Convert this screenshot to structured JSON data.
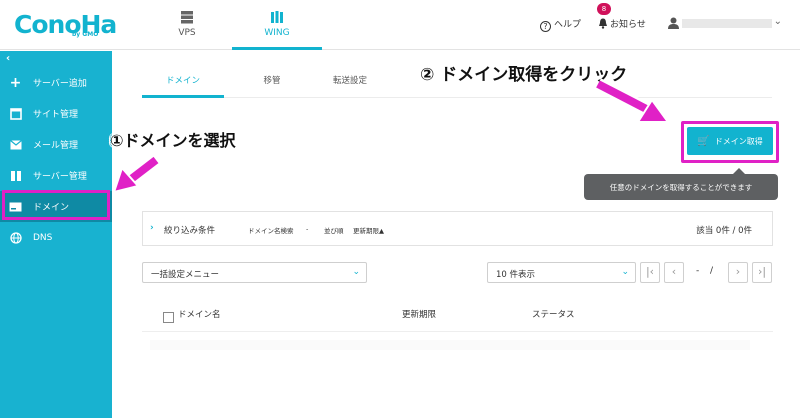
{
  "header": {
    "logo": "ConoHa",
    "logo_sub": "by GMO",
    "nav": [
      {
        "label": "VPS",
        "icon": "server-icon"
      },
      {
        "label": "WING",
        "icon": "wing-icon"
      }
    ],
    "help_label": "ヘルプ",
    "notice_label": "お知らせ",
    "notice_count": "8"
  },
  "sidebar": {
    "back_icon": "‹",
    "items": [
      {
        "label": "サーバー追加",
        "icon": "plus-icon"
      },
      {
        "label": "サイト管理",
        "icon": "window-icon"
      },
      {
        "label": "メール管理",
        "icon": "mail-icon"
      },
      {
        "label": "サーバー管理",
        "icon": "server-manage-icon"
      },
      {
        "label": "ドメイン",
        "icon": "domain-icon"
      },
      {
        "label": "DNS",
        "icon": "globe-icon"
      }
    ]
  },
  "tabs": [
    {
      "label": "ドメイン"
    },
    {
      "label": "移管"
    },
    {
      "label": "転送設定"
    }
  ],
  "main": {
    "acquire_button": "ドメイン取得",
    "tooltip": "任意のドメインを取得することができます",
    "filter": {
      "label": "絞り込み条件",
      "search": "ドメイン名検索",
      "search_val": "-",
      "sort": "並び順",
      "sort_val": "更新期限▲",
      "count": "該当 0件 / 0件"
    },
    "bulk_menu": "一括設定メニュー",
    "per_page": "10 件表示",
    "page_text": "-",
    "page_sep": "/",
    "columns": [
      "ドメイン名",
      "更新期限",
      "ステータス"
    ]
  },
  "annotations": {
    "step1": "①ドメインを選択",
    "step2": "② ドメイン取得をクリック"
  },
  "colors": {
    "accent": "#18b2d0",
    "active": "#0f8aa4",
    "highlight": "#e021c6"
  }
}
